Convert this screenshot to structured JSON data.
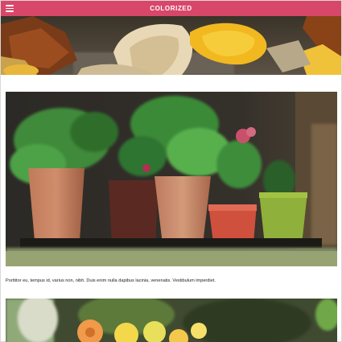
{
  "header": {
    "title": "COLORIZED",
    "menu_icon": "hamburger-menu-icon",
    "color": "#d8476a"
  },
  "hero": {
    "image": "autumn-leaves-photo"
  },
  "card": {
    "image": "potted-plants-photo",
    "caption": "Porttitor eu, tempus id, varius non, nibh. Duis enim nulla dapibus lacinia, venenatis. Vestibulum imperdiet."
  },
  "card2": {
    "image": "yellow-flowers-photo"
  }
}
